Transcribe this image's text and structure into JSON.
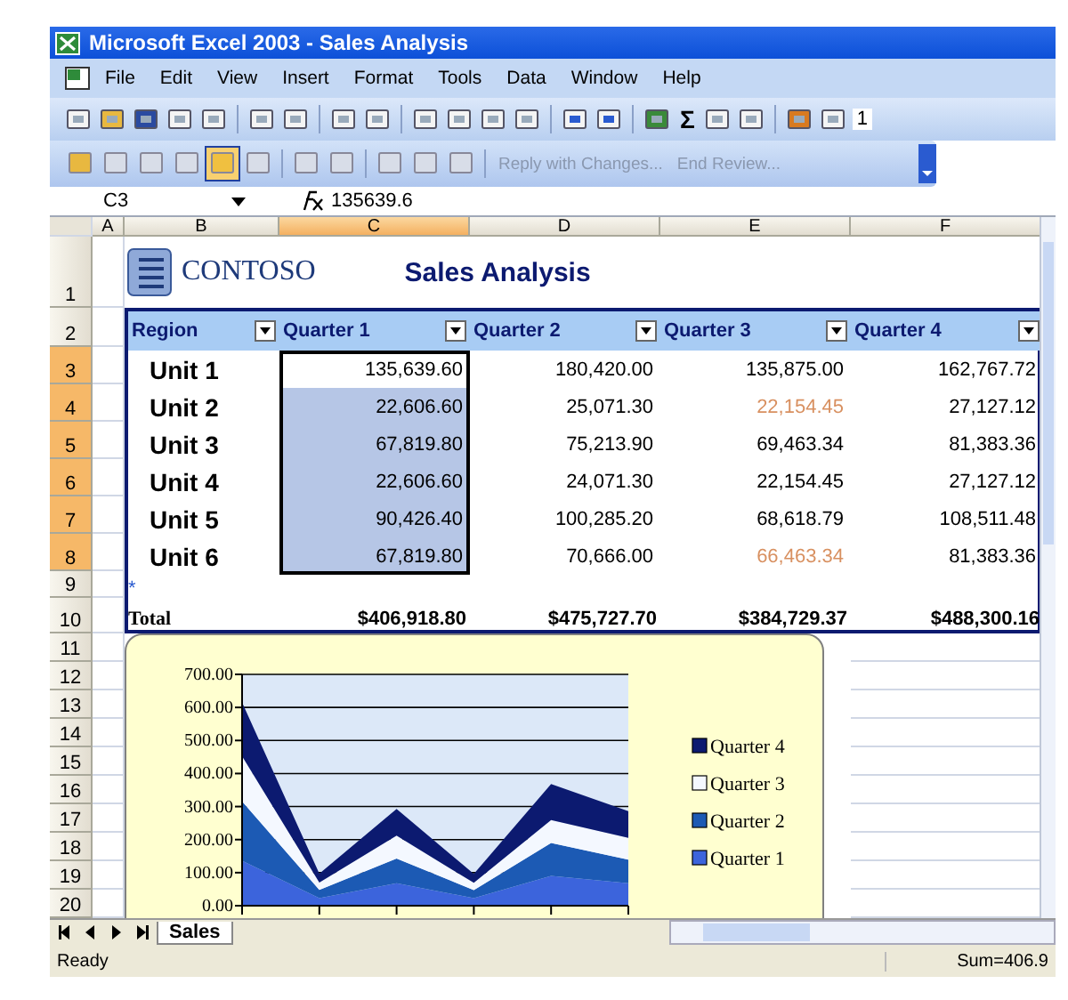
{
  "window": {
    "title": "Microsoft Excel 2003 - Sales Analysis"
  },
  "menu": [
    {
      "label": "File"
    },
    {
      "label": "Edit"
    },
    {
      "label": "View"
    },
    {
      "label": "Insert"
    },
    {
      "label": "Format"
    },
    {
      "label": "Tools"
    },
    {
      "label": "Data"
    },
    {
      "label": "Window"
    },
    {
      "label": "Help"
    }
  ],
  "standard_toolbar": {
    "autosum": "Σ",
    "font_size": "1"
  },
  "reviewing_toolbar": {
    "buttons": [
      {
        "label": "Reply with Changes...",
        "disabled": true
      },
      {
        "label": "End Review...",
        "disabled": true
      }
    ]
  },
  "formula_bar": {
    "name_box": "C3",
    "value": "135639.6"
  },
  "columns": [
    {
      "label": "A",
      "selected": false
    },
    {
      "label": "B",
      "selected": false
    },
    {
      "label": "C",
      "selected": true
    },
    {
      "label": "D",
      "selected": false
    },
    {
      "label": "E",
      "selected": false
    },
    {
      "label": "F",
      "selected": false
    }
  ],
  "row_headers": [
    {
      "label": "1",
      "selected": false
    },
    {
      "label": "2",
      "selected": false
    },
    {
      "label": "3",
      "selected": true
    },
    {
      "label": "4",
      "selected": true
    },
    {
      "label": "5",
      "selected": true
    },
    {
      "label": "6",
      "selected": true
    },
    {
      "label": "7",
      "selected": true
    },
    {
      "label": "8",
      "selected": true
    },
    {
      "label": "9",
      "selected": false
    },
    {
      "label": "10",
      "selected": false
    },
    {
      "label": "11",
      "selected": false
    },
    {
      "label": "12",
      "selected": false
    },
    {
      "label": "13",
      "selected": false
    },
    {
      "label": "14",
      "selected": false
    },
    {
      "label": "15",
      "selected": false
    },
    {
      "label": "16",
      "selected": false
    },
    {
      "label": "17",
      "selected": false
    },
    {
      "label": "18",
      "selected": false
    },
    {
      "label": "19",
      "selected": false
    },
    {
      "label": "20",
      "selected": false
    }
  ],
  "sheet": {
    "logo_text": "CONTOSO",
    "title": "Sales Analysis",
    "list": {
      "headers": [
        "Region",
        "Quarter 1",
        "Quarter 2",
        "Quarter 3",
        "Quarter 4"
      ],
      "rows": [
        {
          "label": "Unit 1",
          "cells": [
            {
              "text": "135,639.60",
              "selected": true,
              "flagged": false
            },
            {
              "text": "180,420.00",
              "selected": false,
              "flagged": false
            },
            {
              "text": "135,875.00",
              "selected": false,
              "flagged": false
            },
            {
              "text": "162,767.72",
              "selected": false,
              "flagged": false
            }
          ]
        },
        {
          "label": "Unit 2",
          "cells": [
            {
              "text": "22,606.60",
              "selected": true,
              "flagged": false
            },
            {
              "text": "25,071.30",
              "selected": false,
              "flagged": false
            },
            {
              "text": "22,154.45",
              "selected": false,
              "flagged": true
            },
            {
              "text": "27,127.12",
              "selected": false,
              "flagged": false
            }
          ]
        },
        {
          "label": "Unit 3",
          "cells": [
            {
              "text": "67,819.80",
              "selected": true,
              "flagged": false
            },
            {
              "text": "75,213.90",
              "selected": false,
              "flagged": false
            },
            {
              "text": "69,463.34",
              "selected": false,
              "flagged": false
            },
            {
              "text": "81,383.36",
              "selected": false,
              "flagged": false
            }
          ]
        },
        {
          "label": "Unit 4",
          "cells": [
            {
              "text": "22,606.60",
              "selected": true,
              "flagged": false
            },
            {
              "text": "24,071.30",
              "selected": false,
              "flagged": false
            },
            {
              "text": "22,154.45",
              "selected": false,
              "flagged": false
            },
            {
              "text": "27,127.12",
              "selected": false,
              "flagged": false
            }
          ]
        },
        {
          "label": "Unit 5",
          "cells": [
            {
              "text": "90,426.40",
              "selected": true,
              "flagged": false
            },
            {
              "text": "100,285.20",
              "selected": false,
              "flagged": false
            },
            {
              "text": "68,618.79",
              "selected": false,
              "flagged": false
            },
            {
              "text": "108,511.48",
              "selected": false,
              "flagged": false
            }
          ]
        },
        {
          "label": "Unit 6",
          "cells": [
            {
              "text": "67,819.80",
              "selected": true,
              "flagged": false
            },
            {
              "text": "70,666.00",
              "selected": false,
              "flagged": false
            },
            {
              "text": "66,463.34",
              "selected": false,
              "flagged": true
            },
            {
              "text": "81,383.36",
              "selected": false,
              "flagged": false
            }
          ]
        }
      ],
      "new_row_marker": "*",
      "total": {
        "label": "Total",
        "cells": [
          "$406,918.80",
          "$475,727.70",
          "$384,729.37",
          "$488,300.16"
        ]
      }
    },
    "chart_data": {
      "type": "area",
      "stacked": true,
      "grid": true,
      "legend": true,
      "ylim": [
        0,
        700
      ],
      "yticks": [
        {
          "value": 0,
          "label": "0.00"
        },
        {
          "value": 100,
          "label": "100.00"
        },
        {
          "value": 200,
          "label": "200.00"
        },
        {
          "value": 300,
          "label": "300.00"
        },
        {
          "value": 400,
          "label": "400.00"
        },
        {
          "value": 500,
          "label": "500.00"
        },
        {
          "value": 600,
          "label": "600.00"
        },
        {
          "value": 700,
          "label": "700.00"
        }
      ],
      "series": [
        {
          "name": "Quarter 1",
          "color": "#3c64dc",
          "values": [
            136,
            23,
            68,
            23,
            90,
            68
          ]
        },
        {
          "name": "Quarter 2",
          "color": "#1c5ab4",
          "values": [
            180,
            25,
            75,
            24,
            100,
            71
          ]
        },
        {
          "name": "Quarter 3",
          "color": "#f4f8ff",
          "values": [
            136,
            22,
            69,
            22,
            69,
            66
          ]
        },
        {
          "name": "Quarter 4",
          "color": "#0c1a70",
          "values": [
            163,
            27,
            81,
            27,
            109,
            81
          ]
        }
      ]
    }
  },
  "sheet_tabs": [
    {
      "label": "Sales",
      "selected": true
    }
  ],
  "status_bar": {
    "status": "Ready",
    "sum": "Sum=406.9"
  }
}
